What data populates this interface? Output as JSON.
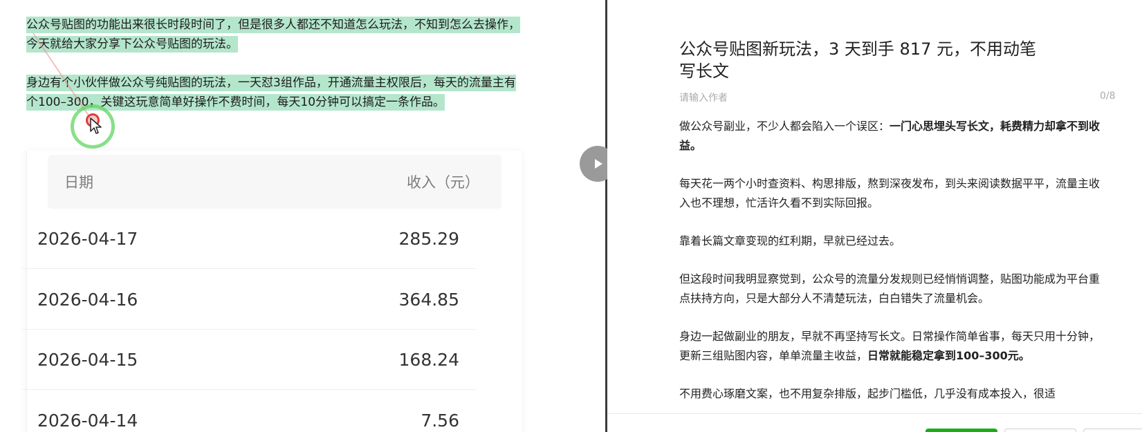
{
  "left": {
    "paragraph1": "公众号贴图的功能出来很长时段时间了，但是很多人都还不知道怎么玩法，不知到怎么去操作，今天就给大家分享下公众号贴图的玩法。",
    "paragraph2": "身边有个小伙伴做公众号纯贴图的玩法，一天怼3组作品，开通流量主权限后，每天的流量主有个100–300，关键这玩意简单好操作不费时间，每天10分钟可以搞定一条作品。",
    "income_table": {
      "header_date": "日期",
      "header_income": "收入（元）",
      "rows": [
        {
          "date": "2026-04-17",
          "income": "285.29"
        },
        {
          "date": "2026-04-16",
          "income": "364.85"
        },
        {
          "date": "2026-04-15",
          "income": "168.24"
        },
        {
          "date": "2026-04-14",
          "income": "7.56"
        }
      ]
    }
  },
  "right": {
    "title": "公众号贴图新玩法，3 天到手 817 元，不用动笔写长文",
    "author_placeholder": "请输入作者",
    "author_count": "0/8",
    "body": {
      "p1_text": "做公众号副业，不少人都会陷入一个误区：",
      "p1_bold": "一门心思埋头写长文，耗费精力却拿不到收益。",
      "p2": "每天花一两个小时查资料、构思排版，熬到深夜发布，到头来阅读数据平平，流量主收入也不理想，忙活许久看不到实际回报。",
      "p3": "靠着长篇文章变现的红利期，早就已经过去。",
      "p4": "但这段时间我明显察觉到，公众号的流量分发规则已经悄悄调整，贴图功能成为平台重点扶持方向，只是大部分人不清楚玩法，白白错失了流量机会。",
      "p5_text": "身边一起做副业的朋友，早就不再坚持写长文。日常操作简单省事，每天只用十分钟，更新三组贴图内容，单单流量主收益，",
      "p5_bold": "日常就能稳定拿到100–300元。",
      "p6": "不用费心琢磨文案，也不用复杂排版，起步门槛低，几乎没有成本投入，很适"
    }
  },
  "colors": {
    "highlight": "#b4e6cc",
    "accent_green": "#1aad19",
    "click_ring": "#60d660",
    "click_dot": "#e23b3b"
  },
  "icons": {
    "play": "play-icon",
    "cursor": "mouse-pointer-icon"
  }
}
